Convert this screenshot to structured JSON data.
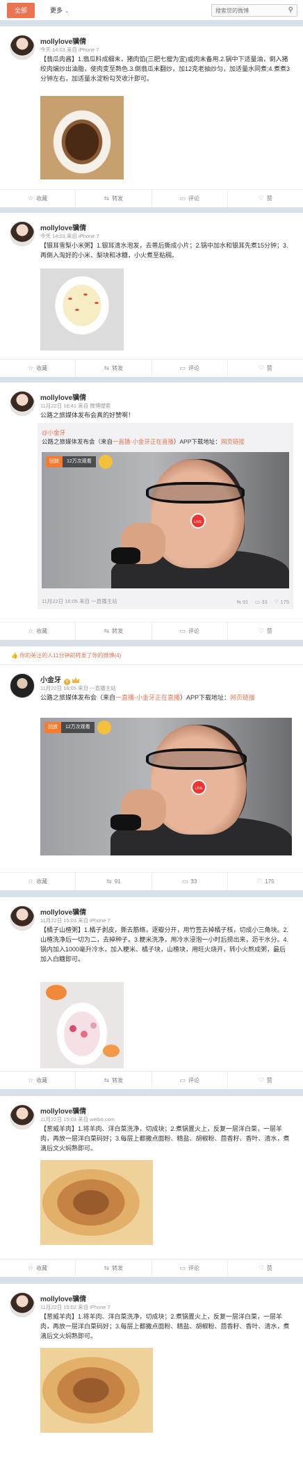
{
  "topbar": {
    "tab_all": "全部",
    "tab_more": "更多",
    "search_placeholder": "搜索您的微博"
  },
  "actions": {
    "collect": "收藏",
    "repost": "转发",
    "comment": "评论",
    "like": "赞"
  },
  "posts": [
    {
      "user": "mollylove骥倩",
      "meta": "今天 14:03 来自 iPhone 7",
      "text": "【翡瓜肉酱】1.翡瓜料成细末，猪肉馅(三肥七瘦为宜)或肉末备用.2.锅中下适量油，倒入猪绞肉煸炒出油脂，使肉变至熟色.3.倒翡瓜末翻炒，加12克老抽炒匀，加适量水同煮;4.煮煮3分钟左右，加适量水淀粉勾芡收汁即可。"
    },
    {
      "user": "mollylove骥倩",
      "meta": "今天 14:03 来自 iPhone 7",
      "text": "【银耳雪梨小米粥】1.银耳清水泡发，去蒂后撕成小片；2.锅中加水和银耳先煮15分钟；3.再倒入淘好的小米、梨块和冰糖，小火煮至粘稠。"
    },
    {
      "user": "mollylove骥倩",
      "meta": "11月22日 16:41 来自 微博搜索",
      "text": "公路之旅媒体发布会真的好赞啊！",
      "repost": {
        "user": "@小金牙",
        "text_before": "公路之旅媒体发布会（来自",
        "link_live": "一直播·小金牙正在直播",
        "text_middle": "）APP下载地址：",
        "link_page": "网页链接",
        "badge": "回放",
        "views": "12万次观看",
        "foot": "11月22日 16:05 来自 一直播主站",
        "repost_count": "转发",
        "comment_count": "33",
        "like_count": "175",
        "share_count": "91"
      }
    },
    {
      "notice": "你的关注的人11分钟前转发了你的微博(4)",
      "user": "小金牙",
      "meta": "11月22日 16:05 来自 一直播主站",
      "text_before": "公路之旅媒体发布会（来自",
      "link_live": "一直播·小金牙正在直播",
      "text_middle": "）APP下载地址：",
      "link_page": "网页链接",
      "badge": "回放",
      "views": "12万次观看",
      "repost_count": "91",
      "comment_count": "33",
      "like_count": "175"
    },
    {
      "user": "mollylove骥倩",
      "meta": "11月22日 15:03 来自 iPhone 7",
      "text": "【橘子山楂粥】1.橘子剥皮，撕去筋络，逐瓣分开，用竹签去掉橘子核，切成小三角块。2.山楂洗净后一切为二，去掉种子。3.粳米洗净，用冷水浸泡一小时后捞出来，沥干水分。4.锅内加入1000毫升冷水，加入粳米、橘子块，山楂块，用旺火烧开，转小火熬成粥，最后加入白糖即可。"
    },
    {
      "user": "mollylove骥倩",
      "meta": "11月22日 15:03 来自 weibo.com",
      "text": "【葱威羊肉】1.将羊肉、洋白菜洗净，切成块；2.煮锅置火上，反复一层洋白菜，一层羊肉，再放一层洋白菜码好；3.每层上都撒点面粉、精盐、胡椒粉、茴香籽、香叶、清水，煮滴后文火焖熟即可。"
    },
    {
      "user": "mollylove骥倩",
      "meta": "11月22日 15:02 来自 iPhone 7",
      "text": "【葱威羊肉】1.将羊肉、洋白菜洗净，切成块；2.煮锅置火上，反复一层洋白菜，一层羊肉，再放一层洋白菜码好；3.每层上都撒点面粉、精盐、胡椒粉、茴香籽、香叶、清水，煮滴后文火焖熟即可。"
    }
  ],
  "colors": {
    "accent": "#eb7350",
    "page_bg": "#d8e1ea",
    "link": "#eb7350"
  }
}
